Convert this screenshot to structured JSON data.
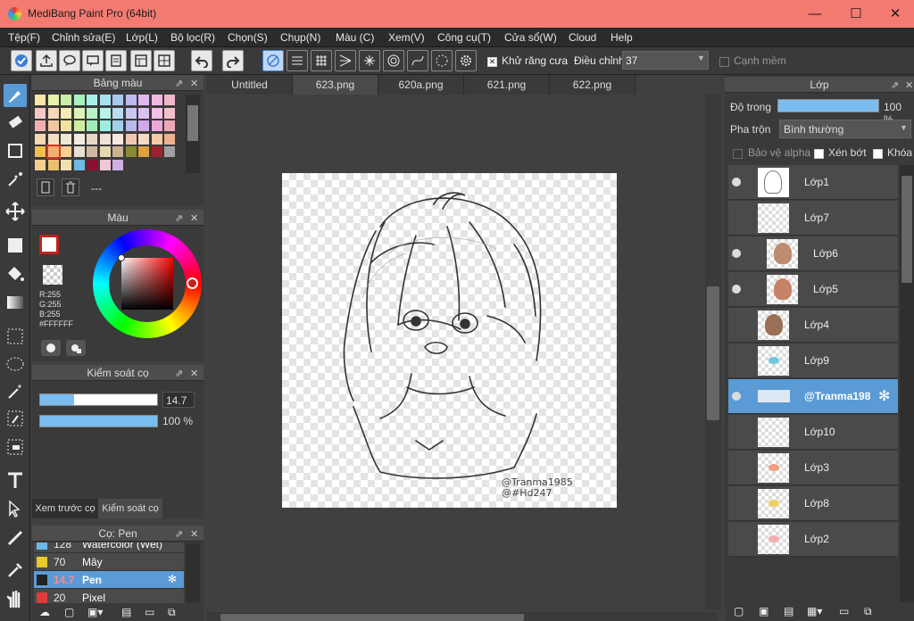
{
  "titlebar": {
    "title": "MediBang Paint Pro (64bit)",
    "minimize": "—",
    "maximize": "☐",
    "close": "✕"
  },
  "menu": [
    "Tệp(F)",
    "Chỉnh sửa(E)",
    "Lớp(L)",
    "Bộ lọc(R)",
    "Chọn(S)",
    "Chụp(N)",
    "Màu (C)",
    "Xem(V)",
    "Công cụ(T)",
    "Cửa sổ(W)",
    "Cloud",
    "Help"
  ],
  "toolbar": {
    "antialias_label": "Khử răng cưa",
    "adjust_label": "Điều chỉnh",
    "adjust_value": "37",
    "edge_label": "Cạnh mềm"
  },
  "palette": {
    "title": "Bảng màu",
    "footer_text": "---"
  },
  "color": {
    "title": "Màu",
    "r": "R:255",
    "g": "G:255",
    "b": "B:255",
    "hex": "#FFFFFF"
  },
  "brush_control": {
    "title": "Kiểm soát cọ",
    "size": "14.7",
    "opacity": "100 %",
    "tab_preview": "Xem trước cọ",
    "tab_control": "Kiểm soát cọ"
  },
  "brush_list": {
    "title": "Cọ: Pen",
    "items": [
      {
        "size": "128",
        "name": "Watercolor (Wet)",
        "color": "#6fb7e8"
      },
      {
        "size": "70",
        "name": "Mây",
        "color": "#e8c92a"
      },
      {
        "size": "14.7",
        "name": "Pen",
        "color": "#222222"
      },
      {
        "size": "20",
        "name": "Pixel",
        "color": "#e03a3a"
      }
    ]
  },
  "tabs": [
    "Untitled",
    "623.png",
    "620a.png",
    "621.png",
    "622.png"
  ],
  "canvas": {
    "watermark_1": "@Tranma1985",
    "watermark_2": "@#Hd247"
  },
  "layers_panel": {
    "title": "Lớp",
    "opacity_label": "Độ trong",
    "opacity_value": "100 %",
    "blend_label": "Pha trộn",
    "blend_value": "Bình thường",
    "protect_alpha": "Bảo vệ alpha",
    "clipping": "Xén bớt",
    "lock": "Khóa",
    "layers": [
      {
        "name": "Lớp1",
        "visible": true
      },
      {
        "name": "Lớp7",
        "visible": false
      },
      {
        "name": "Lớp6",
        "visible": true
      },
      {
        "name": "Lớp5",
        "visible": true
      },
      {
        "name": "Lớp4",
        "visible": false
      },
      {
        "name": "Lớp9",
        "visible": false
      },
      {
        "name": "@Tranma198",
        "visible": true
      },
      {
        "name": "Lớp10",
        "visible": false
      },
      {
        "name": "Lớp3",
        "visible": false
      },
      {
        "name": "Lớp8",
        "visible": false
      },
      {
        "name": "Lớp2",
        "visible": false
      }
    ]
  },
  "colors": {
    "accent": "#5b9bd5",
    "titlebar": "#f37b72",
    "selected_layer": "#5b9bd5",
    "primary_color": "#c0221e"
  }
}
